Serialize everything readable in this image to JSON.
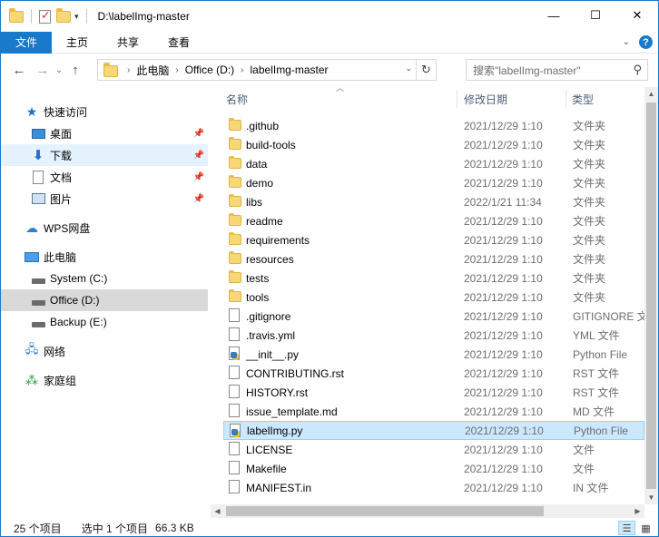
{
  "window": {
    "title": "D:\\labelImg-master",
    "controls": [
      "minimize",
      "maximize",
      "close"
    ]
  },
  "ribbon": {
    "file_tab": "文件",
    "tabs": [
      "主页",
      "共享",
      "查看"
    ]
  },
  "address": {
    "crumbs": [
      "此电脑",
      "Office (D:)",
      "labelImg-master"
    ],
    "search_placeholder": "搜索\"labelImg-master\""
  },
  "nav": {
    "quick_access": "快速访问",
    "items": [
      {
        "label": "桌面",
        "icon": "desktop-icon",
        "pinned": true
      },
      {
        "label": "下载",
        "icon": "download-icon",
        "pinned": true
      },
      {
        "label": "文档",
        "icon": "document-icon",
        "pinned": true
      },
      {
        "label": "图片",
        "icon": "picture-icon",
        "pinned": true
      }
    ],
    "wps": "WPS网盘",
    "this_pc": "此电脑",
    "drives": [
      "System (C:)",
      "Office (D:)",
      "Backup (E:)"
    ],
    "network": "网络",
    "homegroup": "家庭组"
  },
  "columns": {
    "name": "名称",
    "date": "修改日期",
    "type": "类型"
  },
  "files": [
    {
      "name": ".github",
      "date": "2021/12/29 1:10",
      "type": "文件夹",
      "kind": "folder"
    },
    {
      "name": "build-tools",
      "date": "2021/12/29 1:10",
      "type": "文件夹",
      "kind": "folder"
    },
    {
      "name": "data",
      "date": "2021/12/29 1:10",
      "type": "文件夹",
      "kind": "folder"
    },
    {
      "name": "demo",
      "date": "2021/12/29 1:10",
      "type": "文件夹",
      "kind": "folder"
    },
    {
      "name": "libs",
      "date": "2022/1/21 11:34",
      "type": "文件夹",
      "kind": "folder"
    },
    {
      "name": "readme",
      "date": "2021/12/29 1:10",
      "type": "文件夹",
      "kind": "folder"
    },
    {
      "name": "requirements",
      "date": "2021/12/29 1:10",
      "type": "文件夹",
      "kind": "folder"
    },
    {
      "name": "resources",
      "date": "2021/12/29 1:10",
      "type": "文件夹",
      "kind": "folder"
    },
    {
      "name": "tests",
      "date": "2021/12/29 1:10",
      "type": "文件夹",
      "kind": "folder"
    },
    {
      "name": "tools",
      "date": "2021/12/29 1:10",
      "type": "文件夹",
      "kind": "folder"
    },
    {
      "name": ".gitignore",
      "date": "2021/12/29 1:10",
      "type": "GITIGNORE 文",
      "kind": "file"
    },
    {
      "name": ".travis.yml",
      "date": "2021/12/29 1:10",
      "type": "YML 文件",
      "kind": "file"
    },
    {
      "name": "__init__.py",
      "date": "2021/12/29 1:10",
      "type": "Python File",
      "kind": "python"
    },
    {
      "name": "CONTRIBUTING.rst",
      "date": "2021/12/29 1:10",
      "type": "RST 文件",
      "kind": "file"
    },
    {
      "name": "HISTORY.rst",
      "date": "2021/12/29 1:10",
      "type": "RST 文件",
      "kind": "file"
    },
    {
      "name": "issue_template.md",
      "date": "2021/12/29 1:10",
      "type": "MD 文件",
      "kind": "file"
    },
    {
      "name": "labelImg.py",
      "date": "2021/12/29 1:10",
      "type": "Python File",
      "kind": "python",
      "selected": true
    },
    {
      "name": "LICENSE",
      "date": "2021/12/29 1:10",
      "type": "文件",
      "kind": "file"
    },
    {
      "name": "Makefile",
      "date": "2021/12/29 1:10",
      "type": "文件",
      "kind": "file"
    },
    {
      "name": "MANIFEST.in",
      "date": "2021/12/29 1:10",
      "type": "IN 文件",
      "kind": "file"
    }
  ],
  "status": {
    "count": "25 个项目",
    "selection": "选中 1 个项目",
    "size": "66.3 KB"
  }
}
